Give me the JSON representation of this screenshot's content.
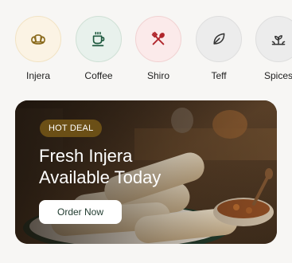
{
  "categories": [
    {
      "label": "Injera",
      "icon": "croissant-icon",
      "bg": "#fbf3e4",
      "border": "#f2e3c4",
      "icon_color": "#8a6a1c"
    },
    {
      "label": "Coffee",
      "icon": "coffee-cup-icon",
      "bg": "#e8f1ec",
      "border": "#cfe0d5",
      "icon_color": "#1f5a3f"
    },
    {
      "label": "Shiro",
      "icon": "utensils-icon",
      "bg": "#fbeaea",
      "border": "#f1d2d2",
      "icon_color": "#b0262c"
    },
    {
      "label": "Teff",
      "icon": "leaf-icon",
      "bg": "#ececec",
      "border": "#dedede",
      "icon_color": "#333333"
    },
    {
      "label": "Spices",
      "icon": "sprout-icon",
      "bg": "#ececec",
      "border": "#dedede",
      "icon_color": "#333333"
    }
  ],
  "banner": {
    "badge": "HOT DEAL",
    "title_line1": "Fresh Injera",
    "title_line2": "Available Today",
    "cta": "Order Now"
  },
  "colors": {
    "page_bg": "#f7f6f4",
    "badge_bg": "#6b4f16",
    "cta_text": "#1f3a2e"
  }
}
